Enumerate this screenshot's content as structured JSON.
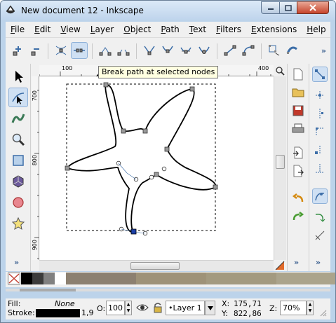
{
  "window": {
    "title": "New document 12 - Inkscape",
    "controls": {
      "minimize_icon": "minimize-icon",
      "maximize_icon": "maximize-icon",
      "close_icon": "close-icon"
    }
  },
  "menubar": {
    "items": [
      "File",
      "Edit",
      "View",
      "Layer",
      "Object",
      "Path",
      "Text",
      "Filters",
      "Extensions",
      "Help"
    ]
  },
  "toolbar": {
    "icons": [
      "insert-node-icon",
      "delete-node-icon",
      "join-nodes-icon",
      "break-path-icon",
      "join-segment-icon",
      "delete-segment-icon",
      "cusp-node-icon",
      "smooth-node-icon",
      "symmetric-node-icon",
      "auto-smooth-node-icon",
      "segment-line-icon",
      "segment-curve-icon",
      "object-to-path-icon",
      "stroke-to-path-icon"
    ],
    "more": "»"
  },
  "tooltip": {
    "text": "Break path at selected nodes"
  },
  "rulers": {
    "horizontal": [
      "100",
      "200",
      "300",
      "400"
    ],
    "vertical": [
      "700",
      "800",
      "900"
    ]
  },
  "left_tools": {
    "icons": [
      "selector-icon",
      "node-editor-icon",
      "tweak-icon",
      "zoom-icon",
      "rectangle-icon",
      "3d-box-icon",
      "ellipse-icon",
      "star-icon"
    ],
    "more": "»"
  },
  "commands_bar": {
    "icons": [
      "new-document-icon",
      "open-icon",
      "save-icon",
      "print-icon",
      "import-icon",
      "export-icon",
      "undo-icon",
      "redo-icon"
    ],
    "more": "»"
  },
  "snap_bar": {
    "icons": [
      "snap-toggle-icon",
      "snap-bbox-icon",
      "snap-bbox-edge-icon",
      "snap-bbox-corner-icon",
      "snap-node-icon",
      "snap-path-icon",
      "snap-cusp-icon",
      "snap-smooth-icon"
    ],
    "more": "»"
  },
  "palette": {
    "colors": [
      "#000000",
      "#3b3b3b",
      "#808080",
      "#ffffff",
      "#8c8070",
      "#9e9278",
      "#a39a80",
      "#aba48c"
    ]
  },
  "statusbar": {
    "fill_label": "Fill:",
    "fill_value": "None",
    "stroke_label": "Stroke:",
    "stroke_width": "1,9",
    "opacity_label": "O:",
    "opacity_value": "100",
    "layer_name": "•Layer 1",
    "x_label": "X:",
    "x_value": "175,71",
    "y_label": "Y:",
    "y_value": "822,86",
    "zoom_label": "Z:",
    "zoom_value": "70%"
  },
  "accent": "#3d6ea8"
}
